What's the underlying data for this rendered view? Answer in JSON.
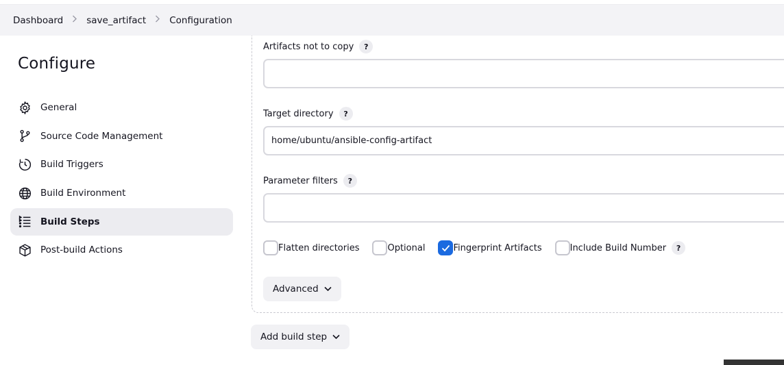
{
  "breadcrumb": {
    "items": [
      "Dashboard",
      "save_artifact",
      "Configuration"
    ],
    "separator": ">"
  },
  "sidebar": {
    "title": "Configure",
    "items": [
      {
        "label": "General",
        "icon": "gear-icon"
      },
      {
        "label": "Source Code Management",
        "icon": "branch-icon"
      },
      {
        "label": "Build Triggers",
        "icon": "clock-icon"
      },
      {
        "label": "Build Environment",
        "icon": "globe-icon"
      },
      {
        "label": "Build Steps",
        "icon": "list-icon",
        "active": true
      },
      {
        "label": "Post-build Actions",
        "icon": "package-icon"
      }
    ]
  },
  "form": {
    "artifacts_not_to_copy": {
      "label": "Artifacts not to copy",
      "value": ""
    },
    "target_directory": {
      "label": "Target directory",
      "value": "home/ubuntu/ansible-config-artifact"
    },
    "parameter_filters": {
      "label": "Parameter filters",
      "value": ""
    },
    "help_glyph": "?",
    "checkboxes": [
      {
        "label": "Flatten directories",
        "checked": false
      },
      {
        "label": "Optional",
        "checked": false
      },
      {
        "label": "Fingerprint Artifacts",
        "checked": true
      },
      {
        "label": "Include Build Number",
        "checked": false
      }
    ],
    "advanced_label": "Advanced",
    "add_build_step_label": "Add build step"
  },
  "colors": {
    "accent": "#1b6ae0",
    "active_bg": "#ececf0",
    "topbar_bg": "#f3f3f6"
  }
}
